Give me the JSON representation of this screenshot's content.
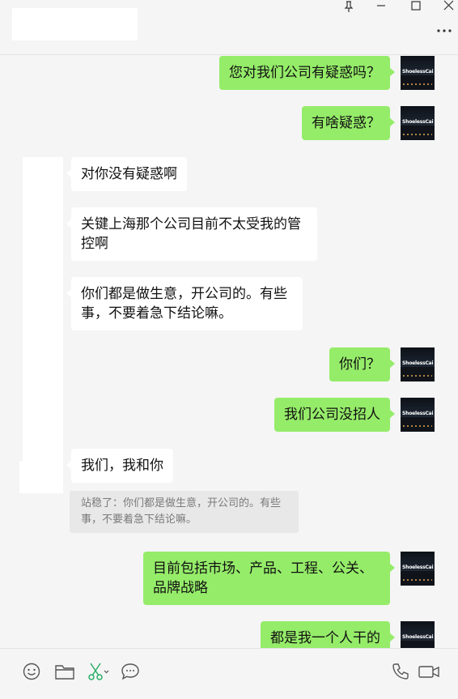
{
  "window": {
    "controls": [
      "pin-icon",
      "minimize-icon",
      "maximize-icon",
      "close-icon",
      "more-icon"
    ]
  },
  "contact": {
    "avatar_text": "ShoelessCai"
  },
  "messages": [
    {
      "side": "me",
      "text": "您对我们公司有疑惑吗？"
    },
    {
      "side": "me",
      "text": "有啥疑惑？"
    },
    {
      "side": "other",
      "text": "对你没有疑惑啊"
    },
    {
      "side": "other",
      "text": "关键上海那个公司目前不太受我的管控啊"
    },
    {
      "side": "other",
      "text": "你们都是做生意，开公司的。有些事，不要着急下结论嘛。"
    },
    {
      "side": "me",
      "text": "你们？"
    },
    {
      "side": "me",
      "text": "我们公司没招人"
    },
    {
      "side": "other",
      "text": "我们，我和你"
    },
    {
      "side": "me",
      "text": "目前包括市场、产品、工程、公关、品牌战略"
    },
    {
      "side": "me",
      "text": "都是我一个人干的"
    }
  ],
  "quote": {
    "text": "站稳了：你们都是做生意，开公司的。有些事，不要着急下结论嘛。"
  },
  "toolbar": {
    "left_tools": [
      "emoji-icon",
      "folder-icon",
      "scissors-icon",
      "chat-history-icon"
    ],
    "right_tools": [
      "phone-icon",
      "video-icon"
    ]
  },
  "colors": {
    "my_bubble": "#95ec69",
    "other_bubble": "#ffffff",
    "background": "#f5f5f5",
    "icon": "#555555"
  }
}
